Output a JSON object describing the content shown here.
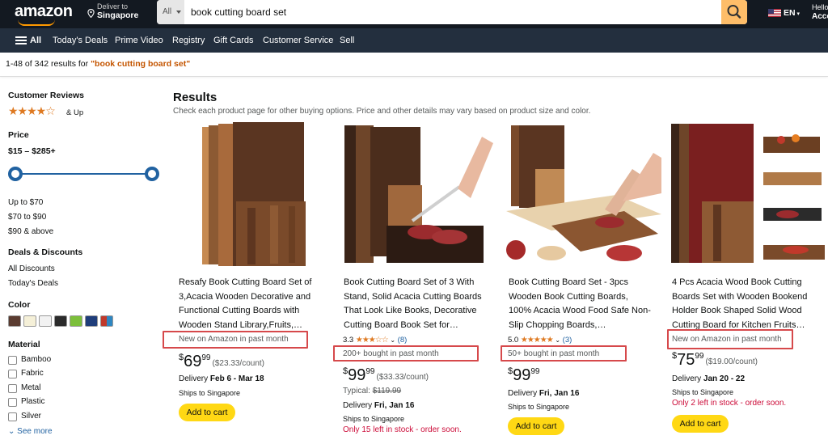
{
  "header": {
    "logo": "amazon",
    "deliver_line1": "Deliver to",
    "deliver_line2": "Singapore",
    "search_category": "All",
    "search_query": "book cutting board set",
    "language": "EN",
    "hello_line1": "Hello",
    "hello_line2": "Acco"
  },
  "nav": {
    "all": "All",
    "items": [
      "Today's Deals",
      "Prime Video",
      "Registry",
      "Gift Cards",
      "Customer Service",
      "Sell"
    ]
  },
  "results_bar": {
    "count_text": "1-48 of 342 results for ",
    "query": "\"book cutting board set\""
  },
  "sidebar": {
    "reviews_heading": "Customer Reviews",
    "reviews_rating": 4,
    "reviews_and_up": "& Up",
    "price_heading": "Price",
    "price_range": "$15 – $285+",
    "price_options": [
      "Up to $70",
      "$70 to $90",
      "$90 & above"
    ],
    "deals_heading": "Deals & Discounts",
    "deals_options": [
      "All Discounts",
      "Today's Deals"
    ],
    "color_heading": "Color",
    "colors": [
      "#5a3b30",
      "#f5f0d8",
      "#f2f2f2",
      "#2b2b2b",
      "#7cbf3b",
      "#1f3d7a",
      "#8a6d5a"
    ],
    "material_heading": "Material",
    "materials": [
      "Bamboo",
      "Fabric",
      "Metal",
      "Plastic",
      "Silver"
    ],
    "see_more": "See more"
  },
  "main": {
    "title": "Results",
    "subtitle": "Check each product page for other buying options. Price and other details may vary based on product size and color."
  },
  "products": [
    {
      "title": "Resafy Book Cutting Board Set of 3,Acacia Wooden Decorative and Functional Cutting Boards with Wooden Stand Library,Fruits,…",
      "badge": "New on Amazon in past month",
      "price_whole": "69",
      "price_cents": "99",
      "unit_price": "($23.33/count)",
      "delivery_label": "Delivery ",
      "delivery_date": "Feb 6 - Mar 18",
      "ships": "Ships to Singapore",
      "cart": "Add to cart"
    },
    {
      "title": "Book Cutting Board Set of 3 With Stand, Solid Acacia Cutting Boards That Look Like Books, Decorative Cutting Board Book Set for…",
      "rating_value": "3.3",
      "rating_count": "(8)",
      "badge": "200+ bought in past month",
      "price_whole": "99",
      "price_cents": "99",
      "unit_price": "($33.33/count)",
      "typical_label": "Typical: ",
      "typical_price": "$119.99",
      "delivery_label": "Delivery ",
      "delivery_date": "Fri, Jan 16",
      "ships": "Ships to Singapore",
      "stock": "Only 15 left in stock - order soon.",
      "cart": "Add to cart"
    },
    {
      "title": "Book Cutting Board Set - 3pcs Wooden Book Cutting Boards, 100% Acacia Wood Food Safe Non-Slip Chopping Boards,…",
      "rating_value": "5.0",
      "rating_count": "(3)",
      "badge": "50+ bought in past month",
      "price_whole": "99",
      "price_cents": "99",
      "delivery_label": "Delivery ",
      "delivery_date": "Fri, Jan 16",
      "ships": "Ships to Singapore",
      "cart": "Add to cart"
    },
    {
      "title": "4 Pcs Acacia Wood Book Cutting Boards Set with Wooden Bookend Holder Book Shaped Solid Wood Cutting Board for Kitchen Fruits…",
      "badge": "New on Amazon in past month",
      "price_whole": "75",
      "price_cents": "99",
      "unit_price": "($19.00/count)",
      "delivery_label": "Delivery ",
      "delivery_date": "Jan 20 - 22",
      "ships": "Ships to Singapore",
      "stock": "Only 2 left in stock - order soon.",
      "cart": "Add to cart"
    }
  ],
  "currency": "$",
  "colors": {
    "header_bg": "#131921",
    "nav_bg": "#232f3e",
    "accent": "#febd69",
    "cart_button": "#ffd814",
    "highlight_box": "#d6494b",
    "stock_red": "#cc0c39",
    "query_orange": "#c45500",
    "star": "#de7921"
  }
}
